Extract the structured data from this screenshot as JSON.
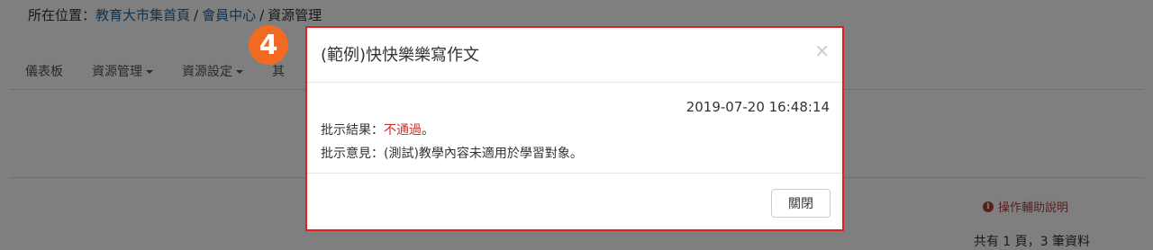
{
  "breadcrumb": {
    "prefix": "所在位置：",
    "home": "教育大市集首頁",
    "separator": "/",
    "member_center": "會員中心",
    "current": "資源管理"
  },
  "nav": {
    "dashboard": "儀表板",
    "resource_manage": "資源管理",
    "resource_settings": "資源設定",
    "partial": "其"
  },
  "help": {
    "label": "操作輔助說明",
    "icon": "info-icon"
  },
  "pager": {
    "info": "共有 1 頁，3 筆資料"
  },
  "step_badge": {
    "number": "4",
    "color": "#f26b22"
  },
  "modal": {
    "title": "(範例)快快樂樂寫作文",
    "close_symbol": "×",
    "timestamp": "2019-07-20 16:48:14",
    "result_label": "批示結果：",
    "result_value": "不通過",
    "result_suffix": "。",
    "comment_label": "批示意見：",
    "comment_value": "(測試)教學內容未適用於學習對象。",
    "close_button": "關閉",
    "border_color": "#e31e24",
    "status_color": "#c9302c"
  }
}
